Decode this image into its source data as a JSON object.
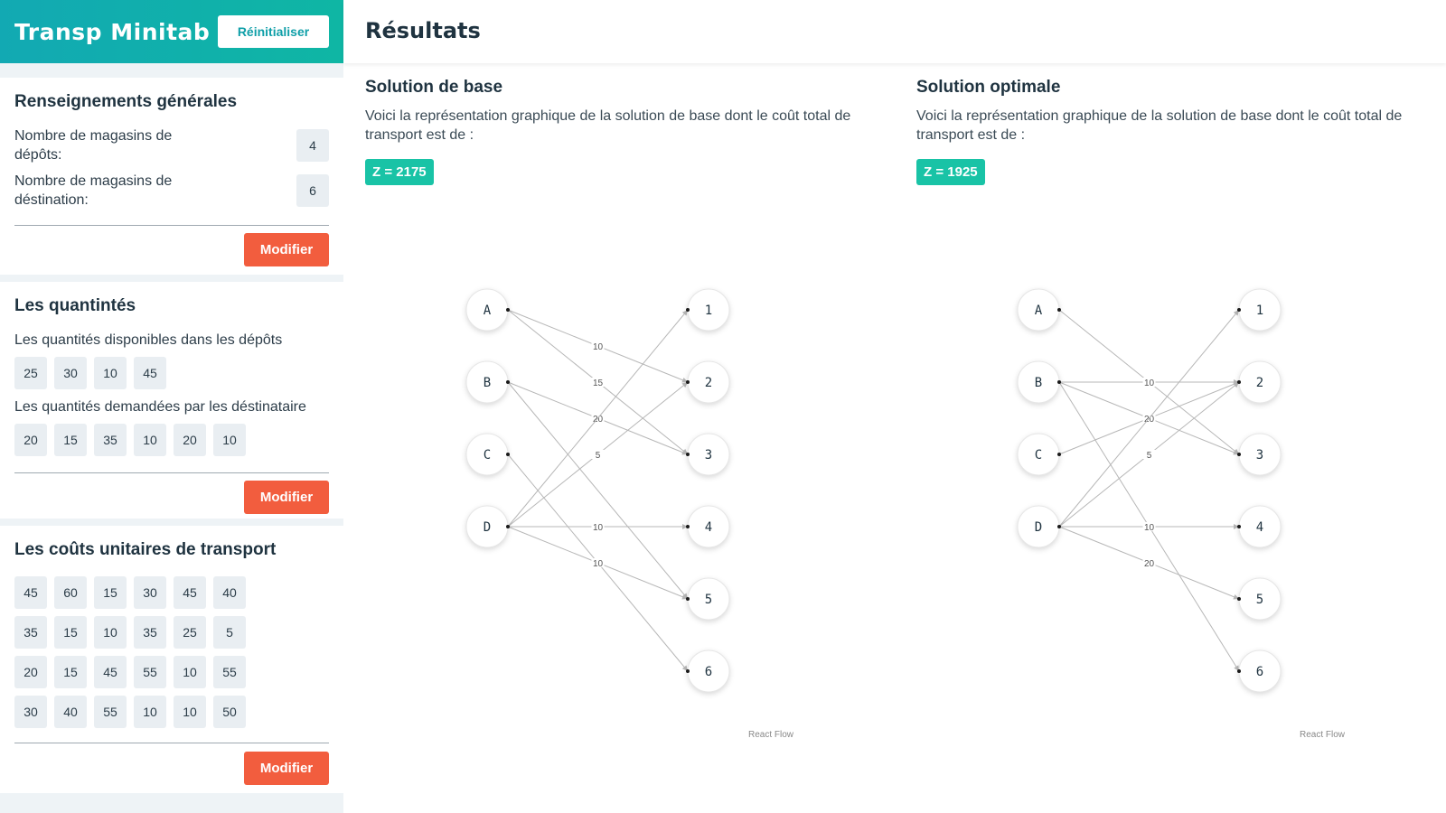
{
  "app_title": "Transp Minitab",
  "reset_label": "Réinitialiser",
  "general": {
    "title": "Renseignements générales",
    "depots_label": "Nombre de magasins de dépôts:",
    "depots_value": "4",
    "destinations_label": "Nombre de magasins de déstination:",
    "destinations_value": "6",
    "modify_label": "Modifier"
  },
  "quantities": {
    "title": "Les quantintés",
    "available_label": "Les quantités disponibles dans les dépôts",
    "available": [
      "25",
      "30",
      "10",
      "45"
    ],
    "demanded_label": "Les quantités demandées par les déstinataire",
    "demanded": [
      "20",
      "15",
      "35",
      "10",
      "20",
      "10"
    ],
    "modify_label": "Modifier"
  },
  "costs": {
    "title": "Les coûts unitaires de transport",
    "rows": [
      [
        "45",
        "60",
        "15",
        "30",
        "45",
        "40"
      ],
      [
        "35",
        "15",
        "10",
        "35",
        "25",
        "5"
      ],
      [
        "20",
        "15",
        "45",
        "55",
        "10",
        "55"
      ],
      [
        "30",
        "40",
        "55",
        "10",
        "10",
        "50"
      ]
    ],
    "modify_label": "Modifier"
  },
  "results": {
    "title": "Résultats",
    "base": {
      "title": "Solution de base",
      "desc": "Voici la représentation graphique de la solution de base dont le coût total de transport est de :",
      "z": "Z = 2175",
      "sources": [
        "A",
        "B",
        "C",
        "D"
      ],
      "targets": [
        "1",
        "2",
        "3",
        "4",
        "5",
        "6"
      ],
      "edges": [
        {
          "from": "A",
          "to": "2",
          "label": "10"
        },
        {
          "from": "A",
          "to": "3",
          "label": "15"
        },
        {
          "from": "B",
          "to": "3",
          "label": "20"
        },
        {
          "from": "B",
          "to": "5",
          "label": ""
        },
        {
          "from": "C",
          "to": "6",
          "label": ""
        },
        {
          "from": "D",
          "to": "1",
          "label": ""
        },
        {
          "from": "D",
          "to": "2",
          "label": "5"
        },
        {
          "from": "D",
          "to": "4",
          "label": "10"
        },
        {
          "from": "D",
          "to": "5",
          "label": "10"
        }
      ],
      "attribution": "React Flow"
    },
    "optimal": {
      "title": "Solution optimale",
      "desc": "Voici la représentation graphique de la solution de base dont le coût total de transport est de :",
      "z": "Z = 1925",
      "sources": [
        "A",
        "B",
        "C",
        "D"
      ],
      "targets": [
        "1",
        "2",
        "3",
        "4",
        "5",
        "6"
      ],
      "edges": [
        {
          "from": "A",
          "to": "3",
          "label": "10"
        },
        {
          "from": "B",
          "to": "2",
          "label": "10"
        },
        {
          "from": "B",
          "to": "3",
          "label": ""
        },
        {
          "from": "B",
          "to": "6",
          "label": "10"
        },
        {
          "from": "C",
          "to": "2",
          "label": "20"
        },
        {
          "from": "D",
          "to": "1",
          "label": ""
        },
        {
          "from": "D",
          "to": "2",
          "label": "5"
        },
        {
          "from": "D",
          "to": "4",
          "label": "10"
        },
        {
          "from": "D",
          "to": "5",
          "label": "20"
        }
      ],
      "attribution": "React Flow"
    }
  }
}
